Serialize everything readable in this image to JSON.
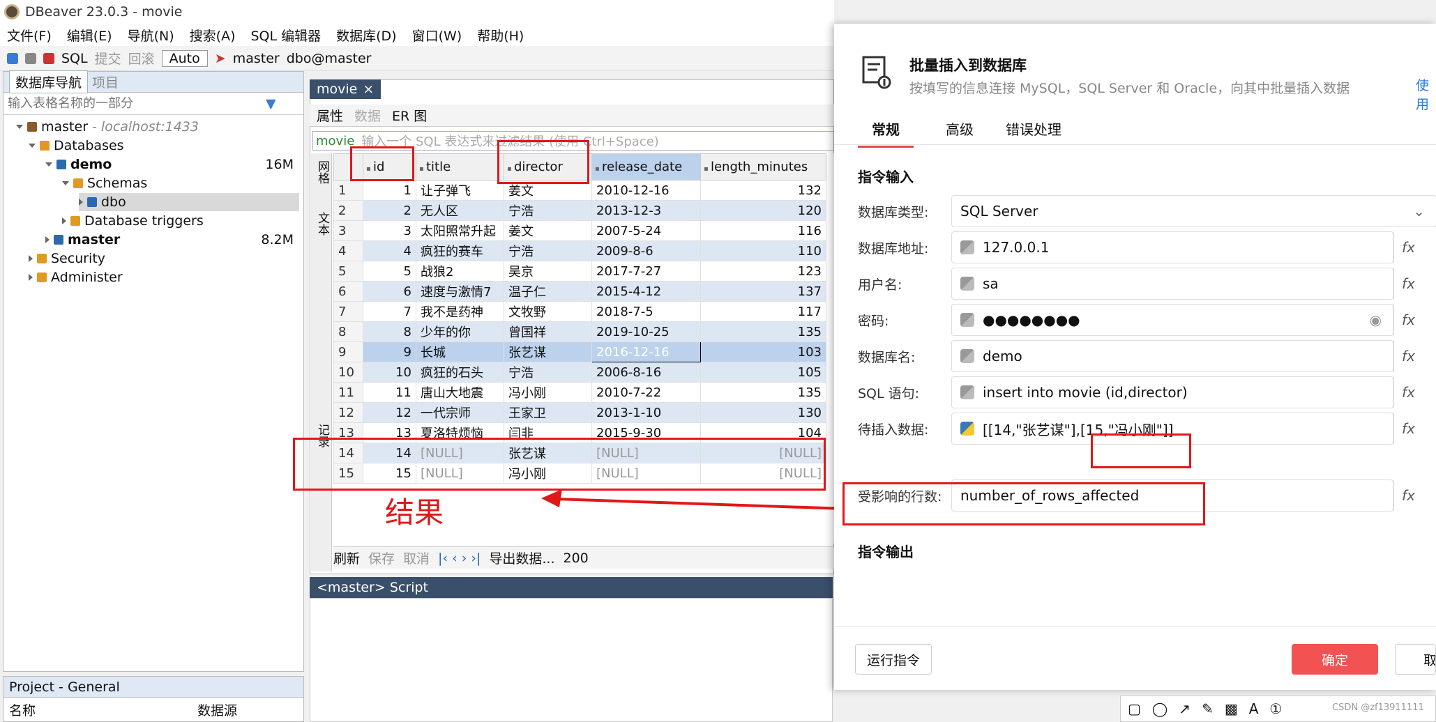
{
  "window": {
    "title": "DBeaver 23.0.3 - movie"
  },
  "menu": [
    "文件(F)",
    "编辑(E)",
    "导航(N)",
    "搜索(A)",
    "SQL 编辑器",
    "数据库(D)",
    "窗口(W)",
    "帮助(H)"
  ],
  "toolbar": {
    "sql": "SQL",
    "commit": "提交",
    "rollback": "回滚",
    "auto": "Auto",
    "connection": "master",
    "schema": "dbo@master"
  },
  "nav": {
    "tab": "数据库导航",
    "tab2": "项目",
    "search_placeholder": "输入表格名称的一部分",
    "tree": [
      {
        "label": "master",
        "extra": " - localhost:1433"
      },
      {
        "label": "Databases"
      },
      {
        "label": "demo",
        "size": "16M"
      },
      {
        "label": "Schemas"
      },
      {
        "label": "dbo"
      },
      {
        "label": "Database triggers"
      },
      {
        "label": "master",
        "size": "8.2M"
      },
      {
        "label": "Security"
      },
      {
        "label": "Administer"
      }
    ]
  },
  "project": {
    "tab": "Project - General",
    "col1": "名称",
    "col2": "数据源"
  },
  "editor": {
    "tab": "movie",
    "subtabs": [
      "属性",
      "数据",
      "ER 图"
    ],
    "filter_table": "movie",
    "filter_placeholder": "输入一个 SQL 表达式来过滤结果 (使用 Ctrl+Space)",
    "vtab1": "网格",
    "vtab2": "文本",
    "vtab3": "记录",
    "columns": [
      "id",
      "title",
      "director",
      "release_date",
      "length_minutes"
    ],
    "rows": [
      [
        "1",
        "1",
        "让子弹飞",
        "姜文",
        "2010-12-16",
        "132"
      ],
      [
        "2",
        "2",
        "无人区",
        "宁浩",
        "2013-12-3",
        "120"
      ],
      [
        "3",
        "3",
        "太阳照常升起",
        "姜文",
        "2007-5-24",
        "116"
      ],
      [
        "4",
        "4",
        "疯狂的赛车",
        "宁浩",
        "2009-8-6",
        "110"
      ],
      [
        "5",
        "5",
        "战狼2",
        "吴京",
        "2017-7-27",
        "123"
      ],
      [
        "6",
        "6",
        "速度与激情7",
        "温子仁",
        "2015-4-12",
        "137"
      ],
      [
        "7",
        "7",
        "我不是药神",
        "文牧野",
        "2018-7-5",
        "117"
      ],
      [
        "8",
        "8",
        "少年的你",
        "曾国祥",
        "2019-10-25",
        "135"
      ],
      [
        "9",
        "9",
        "长城",
        "张艺谋",
        "2016-12-16",
        "103"
      ],
      [
        "10",
        "10",
        "疯狂的石头",
        "宁浩",
        "2006-8-16",
        "105"
      ],
      [
        "11",
        "11",
        "唐山大地震",
        "冯小刚",
        "2010-7-22",
        "135"
      ],
      [
        "12",
        "12",
        "一代宗师",
        "王家卫",
        "2013-1-10",
        "130"
      ],
      [
        "13",
        "13",
        "夏洛特烦恼",
        "闫非",
        "2015-9-30",
        "104"
      ],
      [
        "14",
        "14",
        "[NULL]",
        "张艺谋",
        "[NULL]",
        "[NULL]"
      ],
      [
        "15",
        "15",
        "[NULL]",
        "冯小刚",
        "[NULL]",
        "[NULL]"
      ]
    ],
    "bottom": {
      "refresh": "刷新",
      "save": "保存",
      "cancel": "取消",
      "export": "导出数据...",
      "count": "200"
    },
    "script_tab": "<master> Script"
  },
  "annotation": {
    "result": "结果"
  },
  "dialog": {
    "title": "批量插入到数据库",
    "subtitle": "按填写的信息连接 MySQL，SQL Server 和 Oracle，向其中批量插入数据",
    "help": "使用",
    "tabs": [
      "常规",
      "高级",
      "错误处理"
    ],
    "section_in": "指令输入",
    "section_out": "指令输出",
    "fields": [
      {
        "label": "数据库类型:",
        "value": "SQL Server"
      },
      {
        "label": "数据库地址:",
        "value": "127.0.0.1"
      },
      {
        "label": "用户名:",
        "value": "sa"
      },
      {
        "label": "密码:",
        "value": "●●●●●●●●"
      },
      {
        "label": "数据库名:",
        "value": "demo"
      },
      {
        "label": "SQL 语句:",
        "value": "insert into movie (id,director)"
      },
      {
        "label": "待插入数据:",
        "value": "[[14,\"张艺谋\"],[15,\"冯小刚\"]]"
      },
      {
        "label": "受影响的行数:",
        "value": "number_of_rows_affected"
      }
    ],
    "fx": "fx",
    "run": "运行指令",
    "ok": "确定",
    "cancel": "取"
  },
  "watermark": "CSDN @zf13911111"
}
